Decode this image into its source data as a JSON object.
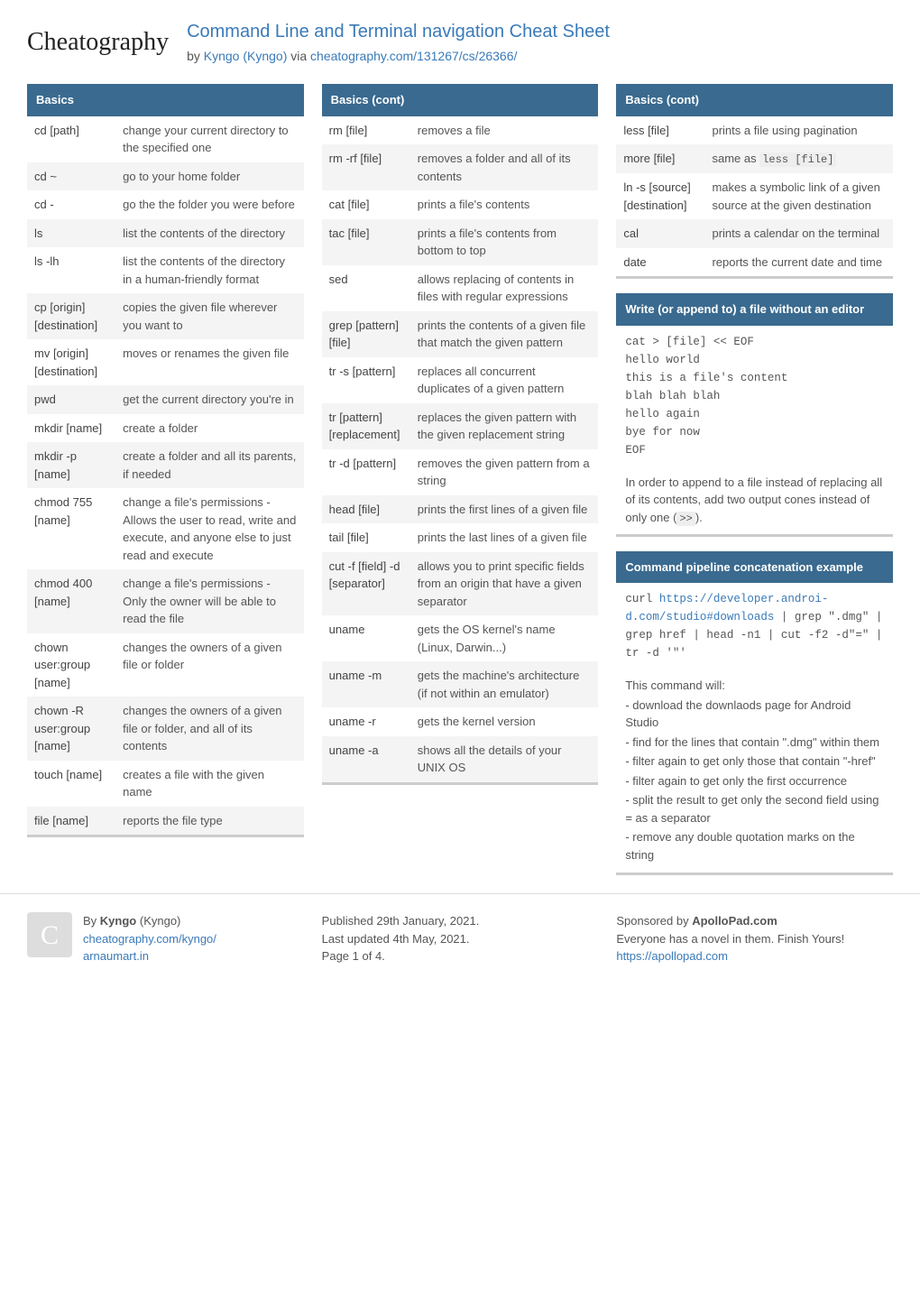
{
  "header": {
    "logo": "Cheatography",
    "title": "Command Line and Terminal navigation Cheat Sheet",
    "by": "by ",
    "author": "Kyngo (Kyngo)",
    "via": " via ",
    "url": "cheatography.com/131267/cs/26366/"
  },
  "col1": {
    "basics": {
      "header": "Basics",
      "rows": [
        {
          "cmd": "cd [path]",
          "desc": "change your current directory to the specified one"
        },
        {
          "cmd": "cd ~",
          "desc": "go to your home folder"
        },
        {
          "cmd": "cd -",
          "desc": "go the the folder you were before"
        },
        {
          "cmd": "ls",
          "desc": "list the contents of the directory"
        },
        {
          "cmd": "ls -lh",
          "desc": "list the contents of the directory in a human-friendly format"
        },
        {
          "cmd": "cp [origin] [desti­nation]",
          "desc": "copies the given file wherever you want to"
        },
        {
          "cmd": "mv [origin] [desti­nation]",
          "desc": "moves or renames the given file"
        },
        {
          "cmd": "pwd",
          "desc": "get the current directory you're in"
        },
        {
          "cmd": "mkdir [name]",
          "desc": "create a folder"
        },
        {
          "cmd": "mkdir -p [name]",
          "desc": "create a folder and all its parents, if needed"
        },
        {
          "cmd": "chmod 755 [name]",
          "desc": "change a file's permissions - Allows the user to read, write and execute, and anyone else to just read and execute"
        },
        {
          "cmd": "chmod 400 [name]",
          "desc": "change a file's permissions - Only the owner will be able to read the file"
        },
        {
          "cmd": "chown user:group [name]",
          "desc": "changes the owners of a given file or folder"
        },
        {
          "cmd": "chown -R user:group [name]",
          "desc": "changes the owners of a given file or folder, and all of its contents"
        },
        {
          "cmd": "touch [name]",
          "desc": "creates a file with the given name"
        },
        {
          "cmd": "file [name]",
          "desc": "reports the file type"
        }
      ]
    }
  },
  "col2": {
    "basics_cont": {
      "header": "Basics (cont)",
      "rows": [
        {
          "cmd": "rm [file]",
          "desc": "removes a file"
        },
        {
          "cmd": "rm -rf [file]",
          "desc": "removes a folder and all of its contents"
        },
        {
          "cmd": "cat [file]",
          "desc": "prints a file's contents"
        },
        {
          "cmd": "tac [file]",
          "desc": "prints a file's contents from bottom to top"
        },
        {
          "cmd": "sed",
          "desc": "allows replacing of contents in files with regular expressions"
        },
        {
          "cmd": "grep [pattern] [file]",
          "desc": "prints the contents of a given file that match the given pattern"
        },
        {
          "cmd": "tr -s [pattern]",
          "desc": "replaces all concurrent duplicates of a given pattern"
        },
        {
          "cmd": "tr [pattern] [repla­cement]",
          "desc": "replaces the given pattern with the given replacement string"
        },
        {
          "cmd": "tr -d [pattern]",
          "desc": "removes the given pattern from a string"
        },
        {
          "cmd": "head [file]",
          "desc": "prints the first lines of a given file"
        },
        {
          "cmd": "tail [file]",
          "desc": "prints the last lines of a given file"
        },
        {
          "cmd": "cut -f [field] -d [separ­ator]",
          "desc": "allows you to print specific fields from an origin that have a given separator"
        },
        {
          "cmd": "uname",
          "desc": "gets the OS kernel's name (Linux, Darwin...)"
        },
        {
          "cmd": "uname -m",
          "desc": "gets the machine's architecture (if not within an emulator)"
        },
        {
          "cmd": "uname -r",
          "desc": "gets the kernel version"
        },
        {
          "cmd": "uname -a",
          "desc": "shows all the details of your UNIX OS"
        }
      ]
    }
  },
  "col3": {
    "basics_cont2": {
      "header": "Basics (cont)",
      "rows": [
        {
          "cmd": "less [file]",
          "desc": "prints a file using pagination"
        },
        {
          "cmd": "more [file]",
          "desc_pre": "same as ",
          "desc_code": "less [file]"
        },
        {
          "cmd": "ln -s [source] [desti­nation]",
          "desc": "makes a symbolic link of a given source at the given destination"
        },
        {
          "cmd": "cal",
          "desc": "prints a calendar on the terminal"
        },
        {
          "cmd": "date",
          "desc": "reports the current date and time"
        }
      ]
    },
    "write_file": {
      "header": "Write (or append to) a file without an editor",
      "code": "cat > [file] << EOF\nhello world\nthis is a file's content\nblah blah blah\nhello again\nbye for now\nEOF",
      "note_pre": "In order to append to a file instead of replacing all of its contents, add two output cones instead of only one (",
      "note_code": ">>",
      "note_post": ")."
    },
    "pipeline": {
      "header": "Command pipeline concatenation example",
      "code_pre": "curl ",
      "code_link": "https://developer.androi­d.com/studio#downloads",
      "code_post": " | grep \".dmg\" | grep href | head -n1 | cut -f2 -d\"=\" | tr -d '\"'",
      "note_lines": [
        "This command will:",
        "- download the downlaods page for Android Studio",
        "- find for the lines that contain \".dmg\" within them",
        "- filter again to get only those that contain \"-href\"",
        "- filter again to get only the first occurrence",
        "- split the result to get only the second field using = as a separator",
        "- remove any double quotation marks on the string"
      ]
    }
  },
  "footer": {
    "author": {
      "by_pre": "By ",
      "by_name": "Kyngo",
      "by_paren": " (Kyngo)",
      "link1": "cheatography.com/kyngo/",
      "link2": "arnaumart.in"
    },
    "pub": {
      "published": "Published 29th January, 2021.",
      "updated": "Last updated 4th May, 2021.",
      "page": "Page 1 of 4."
    },
    "sponsor": {
      "pre": "Sponsored by ",
      "name": "ApolloPad.com",
      "tagline": "Everyone has a novel in them. Finish Yours!",
      "link": "https://apollopad.com"
    }
  }
}
